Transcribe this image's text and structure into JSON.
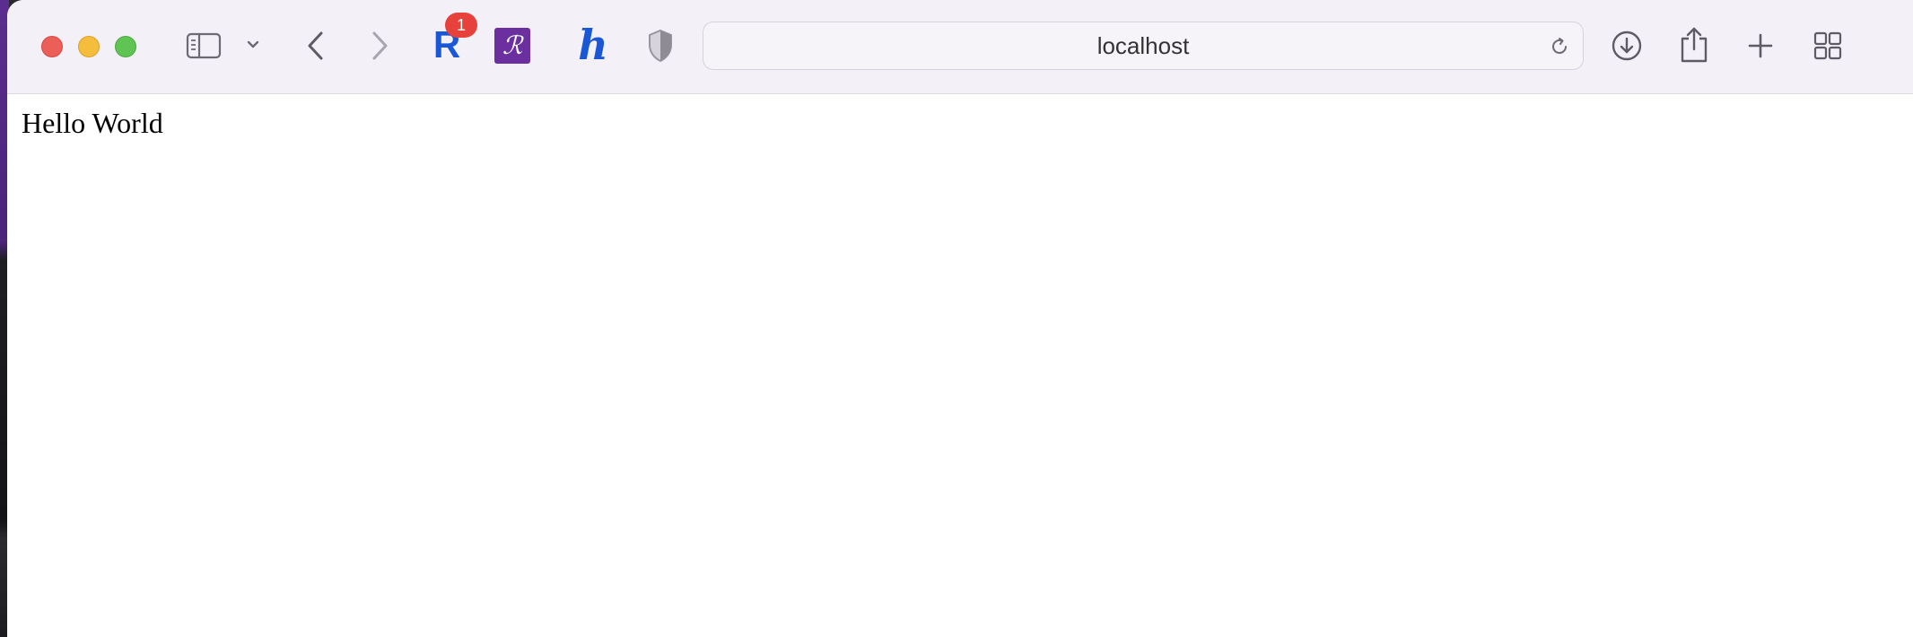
{
  "window": {
    "traffic_lights": [
      "close",
      "minimize",
      "maximize"
    ],
    "colors": {
      "close": "#ec5f58",
      "minimize": "#f4bd3b",
      "maximize": "#5fc454",
      "toolbar_bg": "#f3f0f7"
    }
  },
  "toolbar": {
    "icons": {
      "sidebar": "sidebar-icon",
      "sidebar_menu": "chevron-down-icon",
      "back": "chevron-left-icon",
      "forward": "chevron-right-icon",
      "download": "download-icon",
      "share": "share-icon",
      "new_tab": "plus-icon",
      "tab_overview": "grid-icon",
      "reload": "reload-icon"
    },
    "extensions": {
      "rakuten": {
        "glyph": "R",
        "badge": "1",
        "color": "#1a57d6"
      },
      "roostr": {
        "glyph": "ℛ",
        "color": "#6b2fa0"
      },
      "honey": {
        "glyph": "h",
        "color": "#1a57d6"
      },
      "privacy_shield": {
        "icon": "shield-icon"
      }
    },
    "address": {
      "value": "localhost"
    }
  },
  "page": {
    "text": "Hello World"
  }
}
